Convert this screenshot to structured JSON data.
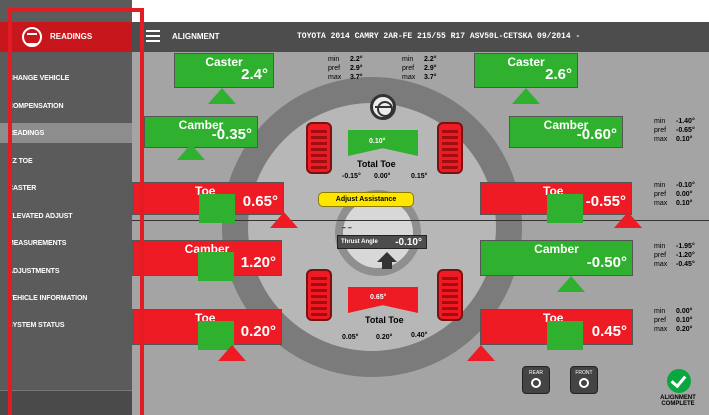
{
  "sidebar": {
    "title": "READINGS",
    "items": [
      {
        "label": "CHANGE VEHICLE"
      },
      {
        "label": "COMPENSATION"
      },
      {
        "label": "READINGS"
      },
      {
        "label": "EZ TOE"
      },
      {
        "label": "CASTER"
      },
      {
        "label": "ELEVATED ADJUST"
      },
      {
        "label": "MEASUREMENTS"
      },
      {
        "label": "ADJUSTMENTS"
      },
      {
        "label": "VEHICLE INFORMATION"
      },
      {
        "label": "SYSTEM STATUS"
      }
    ]
  },
  "topbar": {
    "title": "ALIGNMENT",
    "vehicle": "TOYOTA 2014 CAMRY 2AR-FE 215/55 R17 ASV50L-CETSKA 09/2014 -"
  },
  "front": {
    "caster_spec": {
      "min": "2.2°",
      "pref": "2.9°",
      "max": "3.7°",
      "min_label": "min",
      "pref_label": "pref",
      "max_label": "max"
    },
    "caster_spec_right": {
      "min": "2.2°",
      "pref": "2.9°",
      "max": "3.7°",
      "min_label": "min",
      "pref_label": "pref",
      "max_label": "max"
    },
    "left_caster": {
      "label": "Caster",
      "value": "2.4°"
    },
    "right_caster": {
      "label": "Caster",
      "value": "2.6°"
    },
    "left_camber": {
      "label": "Camber",
      "value": "-0.35°"
    },
    "right_camber": {
      "label": "Camber",
      "value": "-0.60°"
    },
    "right_camber_spec": {
      "min": "-1.40°",
      "pref": "-0.65°",
      "max": "0.10°",
      "min_label": "min",
      "pref_label": "pref",
      "max_label": "max"
    },
    "total_toe_value": "0.10°",
    "total_toe_label": "Total Toe",
    "total_toe_min": "-0.15°",
    "total_toe_pref": "0.00°",
    "total_toe_max": "0.15°",
    "left_toe": {
      "label": "Toe",
      "value": "0.65°"
    },
    "right_toe": {
      "label": "Toe",
      "value": "-0.55°"
    },
    "right_toe_spec": {
      "min": "-0.10°",
      "pref": "0.00°",
      "max": "0.10°",
      "min_label": "min",
      "pref_label": "pref",
      "max_label": "max"
    },
    "adjust_assistance": "Adjust Assistance"
  },
  "rear": {
    "thrust_label": "Thrust Angle",
    "thrust_value": "-0.10°",
    "thrust_marks": "–    –",
    "left_camber": {
      "label": "Camber",
      "value": "1.20°"
    },
    "right_camber": {
      "label": "Camber",
      "value": "-0.50°"
    },
    "right_camber_spec": {
      "min": "-1.95°",
      "pref": "-1.20°",
      "max": "-0.45°",
      "min_label": "min",
      "pref_label": "pref",
      "max_label": "max"
    },
    "total_toe_value": "0.65°",
    "total_toe_label": "Total Toe",
    "total_toe_min": "0.05°",
    "total_toe_pref": "0.20°",
    "total_toe_max": "0.40°",
    "left_toe": {
      "label": "Toe",
      "value": "0.20°"
    },
    "right_toe": {
      "label": "Toe",
      "value": "0.45°"
    },
    "right_toe_spec": {
      "min": "0.00°",
      "pref": "0.10°",
      "max": "0.20°",
      "min_label": "min",
      "pref_label": "pref",
      "max_label": "max"
    }
  },
  "buttons": {
    "rear": "REAR",
    "front": "FRONT",
    "complete": "ALIGNMENT COMPLETE"
  },
  "colors": {
    "good": "#2fb12f",
    "bad": "#ee1b24",
    "header": "#c8161d"
  }
}
